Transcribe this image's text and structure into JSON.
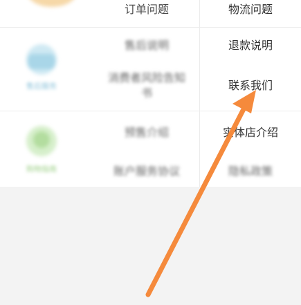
{
  "help_menu": {
    "rows": [
      {
        "mid": "订单问题",
        "right": "物流问题"
      },
      {
        "mid": "售后说明",
        "right": "退款说明"
      },
      {
        "mid": "消费者风险告知书",
        "right": "联系我们"
      },
      {
        "mid": "预售介绍",
        "right": "实体店介绍"
      },
      {
        "mid": "账户服务协议",
        "right": "隐私政策"
      }
    ]
  },
  "categories": [
    {
      "label": "售后服务",
      "icon": "headset-icon",
      "color": "#bfe3f0"
    },
    {
      "label": "购物指南",
      "icon": "guide-icon",
      "color": "#c6e8b8"
    }
  ],
  "colors": {
    "arrow": "#f58a3c"
  }
}
